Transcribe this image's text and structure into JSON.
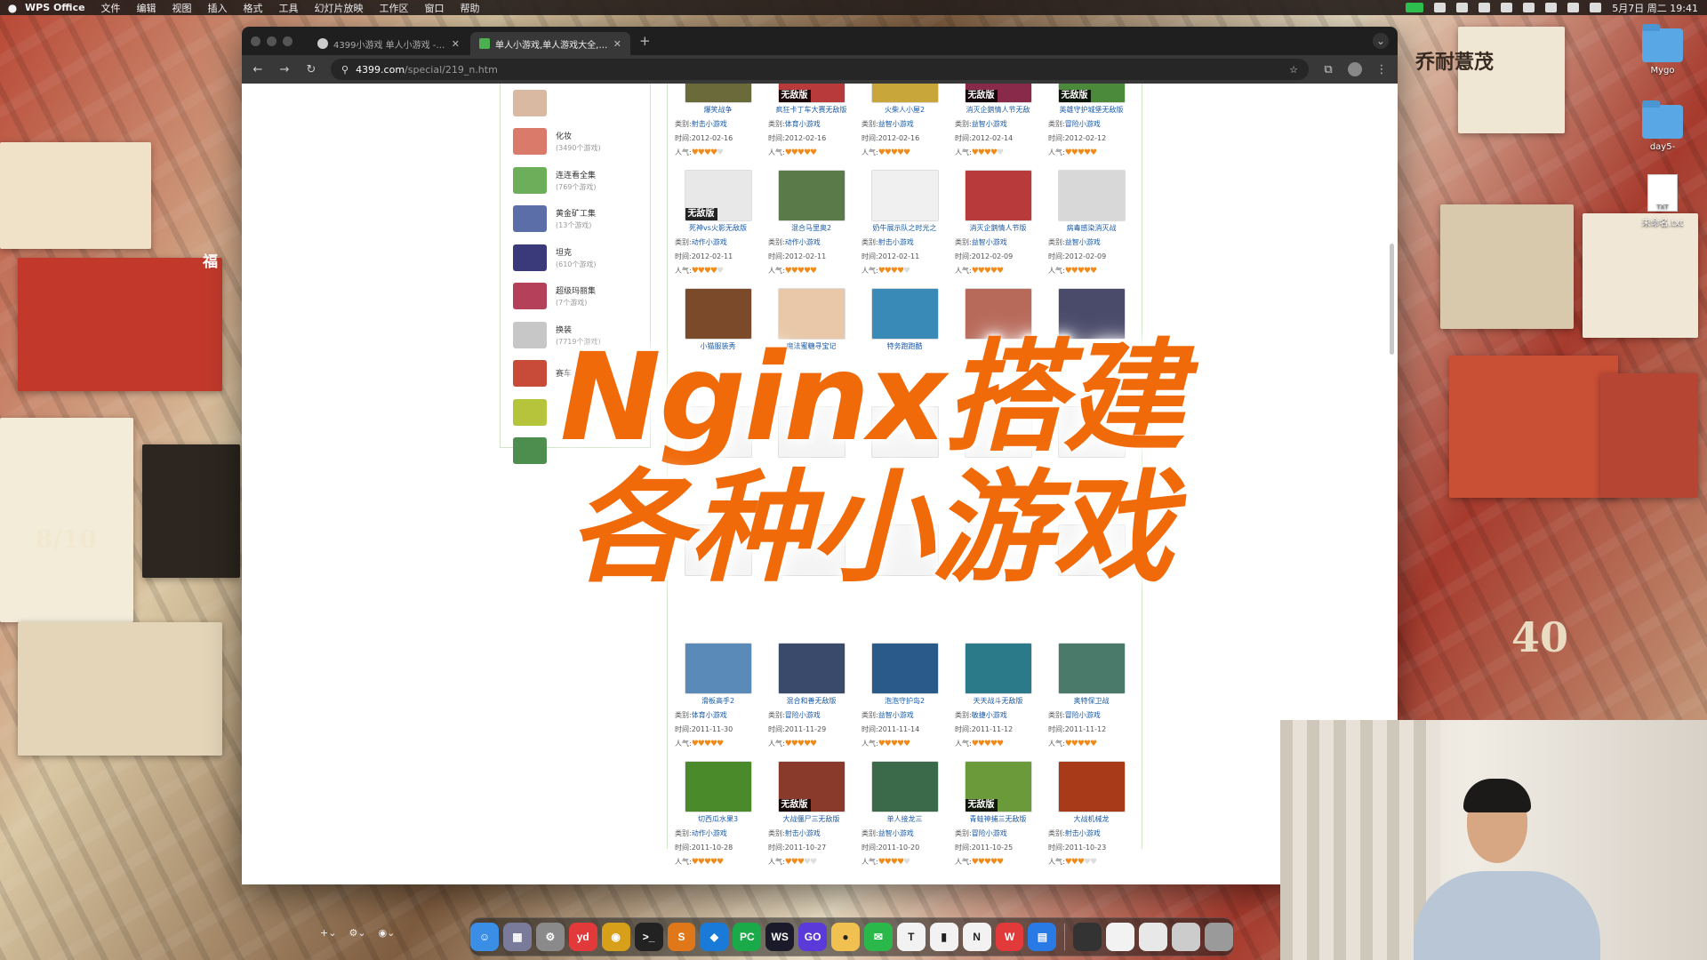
{
  "menubar": {
    "app_name": "WPS Office",
    "items": [
      "文件",
      "编辑",
      "视图",
      "插入",
      "格式",
      "工具",
      "幻灯片放映",
      "工作区",
      "窗口",
      "帮助"
    ],
    "clock": "5月7日 周二 19:41"
  },
  "desktop": {
    "icons": [
      {
        "label": "Mygo",
        "kind": "folder"
      },
      {
        "label": "day5-",
        "kind": "folder"
      },
      {
        "label": "未命名.txt",
        "kind": "txt",
        "badge": "TXT"
      }
    ],
    "wall_text": [
      "8/10",
      "福",
      "乔耐薏茂",
      "40"
    ]
  },
  "browser": {
    "tabs": [
      {
        "title": "4399小游戏 单人小游戏 - Goo",
        "active": false
      },
      {
        "title": "单人小游戏,单人游戏大全,单人",
        "active": true
      }
    ],
    "url_domain": "4399.com",
    "url_path": "/special/219_n.htm"
  },
  "categories": [
    {
      "name": "",
      "count": "",
      "color": "#d9b9a2"
    },
    {
      "name": "化妆",
      "count": "(3490个游戏)",
      "color": "#d97a6a"
    },
    {
      "name": "连连看全集",
      "count": "(769个游戏)",
      "color": "#6cae5a"
    },
    {
      "name": "黄金矿工集",
      "count": "(13个游戏)",
      "color": "#5b6ea8"
    },
    {
      "name": "坦克",
      "count": "(610个游戏)",
      "color": "#3a3a7a"
    },
    {
      "name": "超级玛丽集",
      "count": "(7个游戏)",
      "color": "#b4405a"
    },
    {
      "name": "换装",
      "count": "(7719个游戏)",
      "color": "#c7c7c7"
    },
    {
      "name": "赛车",
      "count": "",
      "color": "#c84b3a"
    },
    {
      "name": "",
      "count": "",
      "color": "#b5c43a"
    },
    {
      "name": "",
      "count": "",
      "color": "#4d8d4d"
    }
  ],
  "labels": {
    "type": "类别:",
    "time": "时间:",
    "popularity": "人气:",
    "ribbon": "无敌版"
  },
  "games": [
    {
      "title": "爆笑战争",
      "cat": "射击小游戏",
      "date": "2012-02-16",
      "stars": 4,
      "color": "#6a6a3a",
      "ribbon": false
    },
    {
      "title": "疯狂卡丁车大赛无敌版",
      "cat": "体育小游戏",
      "date": "2012-02-16",
      "stars": 5,
      "color": "#b83a3a",
      "ribbon": true
    },
    {
      "title": "火柴人小屋2",
      "cat": "益智小游戏",
      "date": "2012-02-16",
      "stars": 5,
      "color": "#c8a63a",
      "ribbon": false
    },
    {
      "title": "消灭企鹅情人节无敌",
      "cat": "益智小游戏",
      "date": "2012-02-14",
      "stars": 4,
      "color": "#8a2a4a",
      "ribbon": true
    },
    {
      "title": "英雄守护城堡无敌版",
      "cat": "冒险小游戏",
      "date": "2012-02-12",
      "stars": 5,
      "color": "#4a8a3a",
      "ribbon": true
    },
    {
      "title": "死神vs火影无敌版",
      "cat": "动作小游戏",
      "date": "2012-02-11",
      "stars": 4,
      "color": "#e8e8e8",
      "ribbon": true
    },
    {
      "title": "混合马里奥2",
      "cat": "动作小游戏",
      "date": "2012-02-11",
      "stars": 5,
      "color": "#5a7a4a",
      "ribbon": false
    },
    {
      "title": "奶牛展示队之时光之",
      "cat": "射击小游戏",
      "date": "2012-02-11",
      "stars": 4,
      "color": "#f0f0f0",
      "ribbon": false
    },
    {
      "title": "消灭企鹅情人节版",
      "cat": "益智小游戏",
      "date": "2012-02-09",
      "stars": 5,
      "color": "#b83a3a",
      "ribbon": false
    },
    {
      "title": "病毒感染消灭战",
      "cat": "益智小游戏",
      "date": "2012-02-09",
      "stars": 5,
      "color": "#d8d8d8",
      "ribbon": false
    },
    {
      "title": "小猫服装秀",
      "cat": "",
      "date": "",
      "stars": 0,
      "color": "#7a4a2a",
      "ribbon": false
    },
    {
      "title": "魔法蜜糖寻宝记",
      "cat": "",
      "date": "",
      "stars": 0,
      "color": "#e8c8a8",
      "ribbon": false
    },
    {
      "title": "特务跑跑酷",
      "cat": "",
      "date": "",
      "stars": 0,
      "color": "#3a8ab8",
      "ribbon": false
    },
    {
      "title": "",
      "cat": "",
      "date": "",
      "stars": 0,
      "color": "#b86a5a",
      "ribbon": false
    },
    {
      "title": "",
      "cat": "",
      "date": "",
      "stars": 0,
      "color": "#4a4a6a",
      "ribbon": false
    },
    {
      "title": "",
      "cat": "",
      "date": "",
      "stars": 0,
      "color": "#f4f4f4",
      "ribbon": false
    },
    {
      "title": "",
      "cat": "",
      "date": "",
      "stars": 0,
      "color": "#f4f4f4",
      "ribbon": false
    },
    {
      "title": "",
      "cat": "",
      "date": "",
      "stars": 0,
      "color": "#f4f4f4",
      "ribbon": false
    },
    {
      "title": "",
      "cat": "",
      "date": "",
      "stars": 0,
      "color": "#f4f4f4",
      "ribbon": false
    },
    {
      "title": "",
      "cat": "",
      "date": "",
      "stars": 0,
      "color": "#f4f4f4",
      "ribbon": false
    },
    {
      "title": "",
      "cat": "",
      "date": "",
      "stars": 0,
      "color": "#f4f4f4",
      "ribbon": false
    },
    {
      "title": "",
      "cat": "",
      "date": "",
      "stars": 0,
      "color": "#f4f4f4",
      "ribbon": false
    },
    {
      "title": "",
      "cat": "",
      "date": "",
      "stars": 0,
      "color": "#f4f4f4",
      "ribbon": false
    },
    {
      "title": "",
      "cat": "",
      "date": "",
      "stars": 0,
      "color": "#f4f4f4",
      "ribbon": false
    },
    {
      "title": "",
      "cat": "",
      "date": "",
      "stars": 0,
      "color": "#f4f4f4",
      "ribbon": false
    },
    {
      "title": "滑板高手2",
      "cat": "体育小游戏",
      "date": "2011-11-30",
      "stars": 5,
      "color": "#5a8ab8",
      "ribbon": false
    },
    {
      "title": "混合和善无敌版",
      "cat": "冒险小游戏",
      "date": "2011-11-29",
      "stars": 5,
      "color": "#3a4a6a",
      "ribbon": false
    },
    {
      "title": "泡泡守护岛2",
      "cat": "益智小游戏",
      "date": "2011-11-14",
      "stars": 5,
      "color": "#2a5a8a",
      "ribbon": false
    },
    {
      "title": "天天战斗无敌版",
      "cat": "敏捷小游戏",
      "date": "2011-11-12",
      "stars": 5,
      "color": "#2a7a8a",
      "ribbon": false
    },
    {
      "title": "奥特保卫战",
      "cat": "冒险小游戏",
      "date": "2011-11-12",
      "stars": 5,
      "color": "#4a7a6a",
      "ribbon": false
    },
    {
      "title": "切西瓜水果3",
      "cat": "动作小游戏",
      "date": "2011-10-28",
      "stars": 5,
      "color": "#4a8a2a",
      "ribbon": false
    },
    {
      "title": "大战僵尸三无敌版",
      "cat": "射击小游戏",
      "date": "2011-10-27",
      "stars": 3,
      "color": "#8a3a2a",
      "ribbon": true
    },
    {
      "title": "单人接龙三",
      "cat": "益智小游戏",
      "date": "2011-10-20",
      "stars": 4,
      "color": "#3a6a4a",
      "ribbon": false
    },
    {
      "title": "青蛙神捕三无敌版",
      "cat": "冒险小游戏",
      "date": "2011-10-25",
      "stars": 5,
      "color": "#6a9a3a",
      "ribbon": true
    },
    {
      "title": "大战机械龙",
      "cat": "射击小游戏",
      "date": "2011-10-23",
      "stars": 3,
      "color": "#a83a1a",
      "ribbon": false
    }
  ],
  "overlay": {
    "line1": "Nginx搭建",
    "line2": "各种小游戏"
  },
  "dock": {
    "apps": [
      {
        "name": "finder-icon",
        "label": "☺",
        "color": "#3a8ee6"
      },
      {
        "name": "launchpad-icon",
        "label": "▦",
        "color": "#7a7a9a"
      },
      {
        "name": "settings-icon",
        "label": "⚙",
        "color": "#8a8a8a"
      },
      {
        "name": "youdao-icon",
        "label": "yd",
        "color": "#e23a3a"
      },
      {
        "name": "chrome-icon",
        "label": "◉",
        "color": "#d8a01a"
      },
      {
        "name": "terminal-icon",
        "label": ">_",
        "color": "#222222"
      },
      {
        "name": "sublime-icon",
        "label": "S",
        "color": "#e0781a"
      },
      {
        "name": "vscode-icon",
        "label": "◆",
        "color": "#1a7ad8"
      },
      {
        "name": "pycharm-icon",
        "label": "PC",
        "color": "#1aaa4a"
      },
      {
        "name": "webstorm-icon",
        "label": "WS",
        "color": "#1a1a2a"
      },
      {
        "name": "goland-icon",
        "label": "GO",
        "color": "#5a3ad8"
      },
      {
        "name": "finder2-icon",
        "label": "●",
        "color": "#f0c050"
      },
      {
        "name": "wechat-icon",
        "label": "✉",
        "color": "#2ab84a"
      },
      {
        "name": "typora-icon",
        "label": "T",
        "color": "#f2f2f2"
      },
      {
        "name": "notes-icon",
        "label": "▮",
        "color": "#f2f2f2"
      },
      {
        "name": "notion-icon",
        "label": "N",
        "color": "#f2f2f2"
      },
      {
        "name": "wps-icon",
        "label": "W",
        "color": "#e23a3a"
      },
      {
        "name": "store-icon",
        "label": "▤",
        "color": "#2a7ae6"
      }
    ],
    "minimized": [
      {
        "name": "minimized-window-1",
        "color": "#333333"
      },
      {
        "name": "minimized-window-2",
        "color": "#f2f2f2"
      },
      {
        "name": "minimized-window-3",
        "color": "#e8e8e8"
      },
      {
        "name": "minimized-window-4",
        "color": "#cccccc"
      },
      {
        "name": "trash-icon",
        "color": "#9a9a9a"
      }
    ]
  }
}
